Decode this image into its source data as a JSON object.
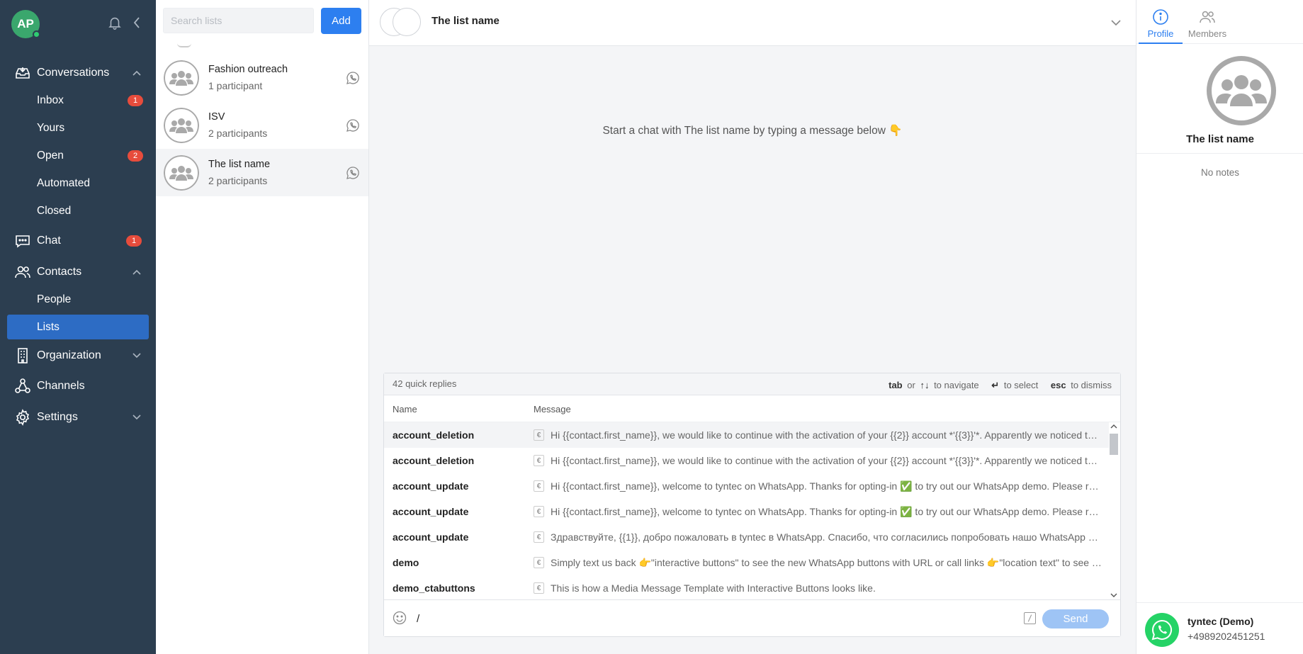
{
  "sidebar": {
    "avatar_initials": "AP",
    "sections": [
      {
        "label": "Conversations"
      },
      {
        "label": "Chat",
        "badge": "1"
      },
      {
        "label": "Contacts"
      },
      {
        "label": "Organization"
      },
      {
        "label": "Channels"
      },
      {
        "label": "Settings"
      }
    ],
    "conversations": [
      {
        "label": "Inbox",
        "badge": "1"
      },
      {
        "label": "Yours"
      },
      {
        "label": "Open",
        "badge": "2"
      },
      {
        "label": "Automated"
      },
      {
        "label": "Closed"
      }
    ],
    "contacts": [
      {
        "label": "People"
      },
      {
        "label": "Lists"
      }
    ]
  },
  "listpanel": {
    "search_placeholder": "Search lists",
    "add_label": "Add",
    "items": [
      {
        "name": "Fashion outreach",
        "sub": "1 participant"
      },
      {
        "name": "ISV",
        "sub": "2 participants"
      },
      {
        "name": "The list name",
        "sub": "2 participants"
      }
    ]
  },
  "main": {
    "title": "The list name",
    "empty_message": "Start a chat with The list name by typing a message below 👇",
    "quick_replies": {
      "count": "42 quick replies",
      "hint_tab": "tab",
      "hint_or": "or",
      "hint_arrows": "↑↓",
      "hint_navigate": "to navigate",
      "hint_enter": "↵",
      "hint_select": "to select",
      "hint_esc": "esc",
      "hint_dismiss": "to dismiss",
      "col_name": "Name",
      "col_message": "Message",
      "rows": [
        {
          "name": "account_deletion",
          "message": "Hi {{contact.first_name}}, we would like to continue with the activation of your {{2}} account *'{{3}}'*. Apparently we noticed that your account is inactive"
        },
        {
          "name": "account_deletion",
          "message": "Hi {{contact.first_name}}, we would like to continue with the activation of your {{2}} account *'{{3}}'*. Apparently we noticed that your account is inactive"
        },
        {
          "name": "account_update",
          "message": "Hi {{contact.first_name}}, welcome to tyntec on WhatsApp. Thanks for opting-in ✅ to try out our WhatsApp demo. Please reply to continue"
        },
        {
          "name": "account_update",
          "message": "Hi {{contact.first_name}}, welcome to tyntec on WhatsApp. Thanks for opting-in ✅ to try out our WhatsApp demo. Please reply to continue"
        },
        {
          "name": "account_update",
          "message": "Здравствуйте, {{1}}, добро пожаловать в tyntec в WhatsApp. Спасибо, что согласились попробовать нашо WhatsApp демо"
        },
        {
          "name": "demo",
          "message": "Simply text us back 👉\"interactive buttons\" to see the new WhatsApp buttons with URL or call links 👉\"location text\" to see more"
        },
        {
          "name": "demo_ctabuttons",
          "message": "This is how a Media Message Template with Interactive Buttons looks like."
        }
      ],
      "euro_symbol": "€"
    },
    "compose": {
      "value": "/",
      "send_label": "Send"
    }
  },
  "profile": {
    "tab_profile": "Profile",
    "tab_members": "Members",
    "name": "The list name",
    "notes": "No notes",
    "channel_name": "tyntec (Demo)",
    "channel_phone": "+4989202451251"
  },
  "colors": {
    "sidebar_bg": "#2c3e50",
    "active_item": "#2d6cc4",
    "accent": "#2d7ff0",
    "badge": "#e74c3c",
    "whatsapp": "#25d366"
  }
}
